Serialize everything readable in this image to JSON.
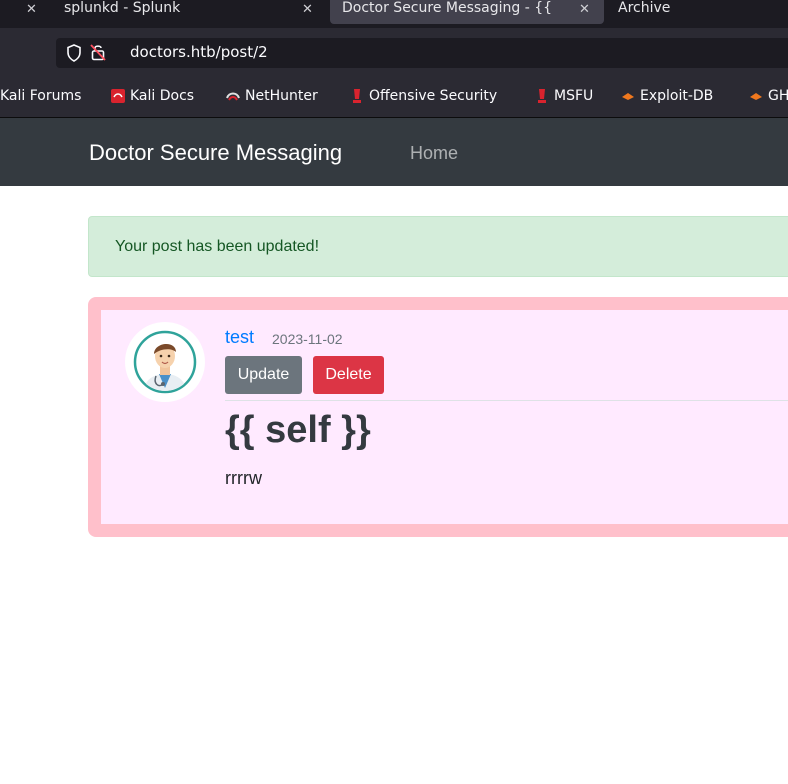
{
  "browser": {
    "tabs": [
      {
        "title": "splunkd - Splunk",
        "active": false
      },
      {
        "title": "Doctor Secure Messaging - {{",
        "active": true
      },
      {
        "title": "Archive",
        "active": false
      }
    ],
    "url": "doctors.htb/post/2",
    "bookmarks": [
      {
        "label": "Kali Forums",
        "icon": "kali-forums-icon"
      },
      {
        "label": "Kali Docs",
        "icon": "kali-docs-icon"
      },
      {
        "label": "NetHunter",
        "icon": "nethunter-icon"
      },
      {
        "label": "Offensive Security",
        "icon": "offsec-icon"
      },
      {
        "label": "MSFU",
        "icon": "offsec-icon"
      },
      {
        "label": "Exploit-DB",
        "icon": "exploit-db-icon"
      },
      {
        "label": "GH",
        "icon": "exploit-db-icon"
      }
    ]
  },
  "site_nav": {
    "brand": "Doctor Secure Messaging",
    "home": "Home",
    "background": "#343a40"
  },
  "alert": {
    "message": "Your post has been updated!",
    "color": "#155724",
    "background": "#d4edda"
  },
  "post": {
    "author": "test",
    "date": "2023-11-02",
    "update_label": "Update",
    "delete_label": "Delete",
    "title": "{{ self }}",
    "body": "rrrrw",
    "border_color": "#ffc0cb",
    "background": "#ffeaff",
    "avatar": "doctor-avatar-icon"
  }
}
